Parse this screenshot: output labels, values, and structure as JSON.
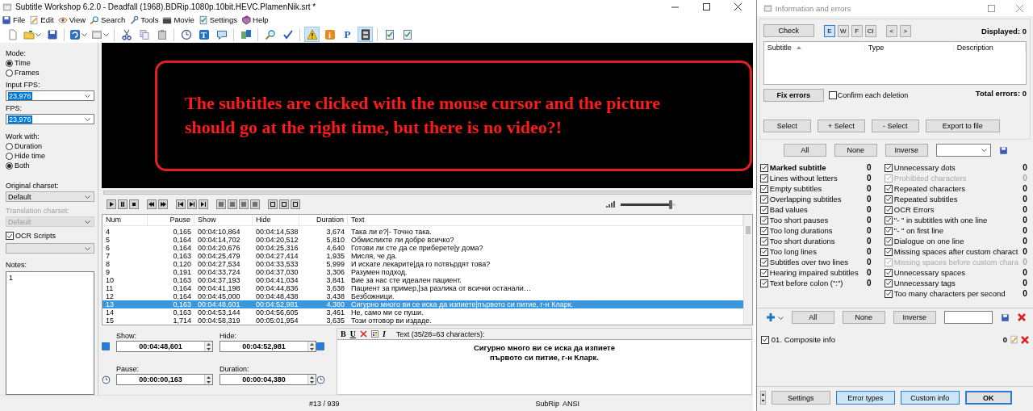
{
  "window": {
    "title": "Subtitle Workshop 6.2.0 - Deadfall (1968).BDRip.1080p.10bit.HEVC.PlamenNik.srt *"
  },
  "menu": [
    {
      "label": "File"
    },
    {
      "label": "Edit"
    },
    {
      "label": "View"
    },
    {
      "label": "Search"
    },
    {
      "label": "Tools"
    },
    {
      "label": "Movie"
    },
    {
      "label": "Settings"
    },
    {
      "label": "Help"
    }
  ],
  "toolbar": [
    {
      "selected": false
    },
    {
      "selected": false
    },
    {
      "selected": false
    },
    {
      "selected": false
    },
    {
      "selected": false
    },
    {
      "selected": false
    },
    {
      "selected": false
    },
    {
      "selected": false
    },
    {
      "selected": false
    },
    {
      "selected": false,
      "label": "T"
    },
    {
      "selected": false
    },
    {
      "selected": false
    },
    {
      "selected": false
    },
    {
      "selected": false
    },
    {
      "selected": true
    },
    {
      "selected": false,
      "label": "i"
    },
    {
      "selected": false,
      "label": "P"
    },
    {
      "selected": true
    },
    {
      "selected": false
    },
    {
      "selected": false
    }
  ],
  "side_panel": {
    "mode": {
      "label": "Mode:",
      "options": [
        {
          "label": "Time",
          "selected": true
        },
        {
          "label": "Frames",
          "selected": false
        }
      ]
    },
    "input_fps": {
      "label": "Input FPS:",
      "value": "23,976",
      "highlighted": true
    },
    "fps": {
      "label": "FPS:",
      "value": "23,976",
      "highlighted": true
    },
    "work_with": {
      "label": "Work with:",
      "options": [
        {
          "label": "Duration",
          "selected": false
        },
        {
          "label": "Hide time",
          "selected": false
        },
        {
          "label": "Both",
          "selected": true
        }
      ]
    },
    "original_charset": {
      "label": "Original charset:",
      "value": "Default",
      "disabled": false
    },
    "translation_charset": {
      "label": "Translation charset:",
      "value": "Default",
      "disabled": true
    },
    "ocr_scripts": {
      "label": "OCR Scripts",
      "checked": true
    },
    "notes": {
      "label": "Notes:",
      "value": "1"
    }
  },
  "video": {
    "annotation": "The subtitles are clicked with the mouse cursor and the picture should go at the right time, but there is no video?!"
  },
  "player": {
    "seek": {
      "level": 0
    },
    "volume": {
      "level": 0.92
    }
  },
  "table": {
    "columns": [
      "Num",
      "Pause",
      "Show",
      "Hide",
      "Duration",
      "Text"
    ],
    "rows": [
      {
        "cells": [
          "4",
          "0,165",
          "00:04:10,864",
          "00:04:14,538",
          "3,674",
          "Така ли е?|- Точно така."
        ],
        "selected": false
      },
      {
        "cells": [
          "5",
          "0,164",
          "00:04:14,702",
          "00:04:20,512",
          "5,810",
          "Обмислихте ли добре всичко?"
        ],
        "selected": false
      },
      {
        "cells": [
          "6",
          "0,164",
          "00:04:20,676",
          "00:04:25,316",
          "4,640",
          "Готови ли сте да се приберете|у дома?"
        ],
        "selected": false
      },
      {
        "cells": [
          "7",
          "0,163",
          "00:04:25,479",
          "00:04:27,414",
          "1,935",
          "Мисля, че да."
        ],
        "selected": false
      },
      {
        "cells": [
          "8",
          "0,120",
          "00:04:27,534",
          "00:04:33,533",
          "5,999",
          "И искате лекарите|да го потвърдят това?"
        ],
        "selected": false
      },
      {
        "cells": [
          "9",
          "0,191",
          "00:04:33,724",
          "00:04:37,030",
          "3,306",
          "Разумен подход."
        ],
        "selected": false
      },
      {
        "cells": [
          "10",
          "0,163",
          "00:04:37,193",
          "00:04:41,034",
          "3,841",
          "Вие за нас сте идеален пациент."
        ],
        "selected": false
      },
      {
        "cells": [
          "11",
          "0,164",
          "00:04:41,198",
          "00:04:44,836",
          "3,638",
          "Пациент за пример,|за разлика от всички останали…"
        ],
        "selected": false
      },
      {
        "cells": [
          "12",
          "0,164",
          "00:04:45,000",
          "00:04:48,438",
          "3,438",
          "Безбожници."
        ],
        "selected": false
      },
      {
        "cells": [
          "13",
          "0,163",
          "00:04:48,601",
          "00:04:52,981",
          "4,380",
          "Сигурно много ви се иска да изпиете|първото си питие, г-н Кларк."
        ],
        "selected": true
      },
      {
        "cells": [
          "14",
          "0,163",
          "00:04:53,144",
          "00:04:56,605",
          "3,461",
          "Не, само ми се пуши."
        ],
        "selected": false
      },
      {
        "cells": [
          "15",
          "1,714",
          "00:04:58,319",
          "00:05:01,954",
          "3,635",
          "Този отговор ви издаде."
        ],
        "selected": false
      }
    ]
  },
  "editor": {
    "show": {
      "label": "Show:",
      "value": "00:04:48,601"
    },
    "hide": {
      "label": "Hide:",
      "value": "00:04:52,981"
    },
    "pause": {
      "label": "Pause:",
      "value": "00:00:00,163"
    },
    "duration": {
      "label": "Duration:",
      "value": "00:00:04,380"
    },
    "format_buttons": [
      {
        "kind": "bold",
        "label": "B"
      },
      {
        "kind": "underline",
        "label": "U"
      },
      {
        "kind": "clear"
      },
      {
        "kind": "color"
      },
      {
        "kind": "italic",
        "label": "I"
      }
    ],
    "text_label": "Text (35/28=63 characters):",
    "text_lines": [
      "Сигурно много ви се иска да изпиете",
      "първото си питие, г-н Кларк."
    ]
  },
  "status_bar": {
    "position": "#13 / 939",
    "format": "SubRip",
    "charset": "ANSI"
  },
  "info_panel": {
    "title": "Information and errors",
    "check_button": "Check",
    "filters": [
      {
        "label": "E",
        "selected": true
      },
      {
        "label": "W",
        "selected": false
      },
      {
        "label": "F",
        "selected": false
      },
      {
        "label": "CI",
        "selected": false
      }
    ],
    "nav": [
      "<",
      ">"
    ],
    "displayed": "Displayed: 0",
    "error_columns": [
      "Subtitle",
      "Type",
      "Description"
    ],
    "fix_button": "Fix errors",
    "confirm": {
      "label": "Confirm each deletion",
      "checked": false
    },
    "total": "Total errors: 0",
    "select_buttons": [
      "Select",
      "+ Select",
      "- Select",
      "Export to file"
    ],
    "filter_buttons": [
      "All",
      "None",
      "Inverse"
    ],
    "checks_left": [
      {
        "label": "Marked subtitle",
        "checked": true,
        "disabled": false,
        "bold": true,
        "count": "0"
      },
      {
        "label": "Lines without letters",
        "checked": true,
        "disabled": false,
        "bold": false,
        "count": "0"
      },
      {
        "label": "Empty subtitles",
        "checked": true,
        "disabled": false,
        "bold": false,
        "count": "0"
      },
      {
        "label": "Overlapping subtitles",
        "checked": true,
        "disabled": false,
        "bold": false,
        "count": "0"
      },
      {
        "label": "Bad values",
        "checked": true,
        "disabled": false,
        "bold": false,
        "count": "0"
      },
      {
        "label": "Too short pauses",
        "checked": true,
        "disabled": false,
        "bold": false,
        "count": "0"
      },
      {
        "label": "Too long durations",
        "checked": true,
        "disabled": false,
        "bold": false,
        "count": "0"
      },
      {
        "label": "Too short durations",
        "checked": true,
        "disabled": false,
        "bold": false,
        "count": "0"
      },
      {
        "label": "Too long lines",
        "checked": true,
        "disabled": false,
        "bold": false,
        "count": "0"
      },
      {
        "label": "Subtitles over two lines",
        "checked": true,
        "disabled": false,
        "bold": false,
        "count": "0"
      },
      {
        "label": "Hearing impaired subtitles",
        "checked": true,
        "disabled": false,
        "bold": false,
        "count": "0"
      },
      {
        "label": "Text before colon (\":\")",
        "checked": true,
        "disabled": false,
        "bold": false,
        "count": "0"
      }
    ],
    "checks_right": [
      {
        "label": "Unnecessary dots",
        "checked": true,
        "disabled": false,
        "bold": false,
        "count": "0"
      },
      {
        "label": "Prohibited characters",
        "checked": true,
        "disabled": true,
        "bold": false,
        "count": "0"
      },
      {
        "label": "Repeated characters",
        "checked": true,
        "disabled": false,
        "bold": false,
        "count": "0"
      },
      {
        "label": "Repeated subtitles",
        "checked": true,
        "disabled": false,
        "bold": false,
        "count": "0"
      },
      {
        "label": "OCR Errors",
        "checked": true,
        "disabled": false,
        "bold": false,
        "count": "0"
      },
      {
        "label": "\"- \" in subtitles with one line",
        "checked": true,
        "disabled": false,
        "bold": false,
        "count": "0"
      },
      {
        "label": "\"- \" on first line",
        "checked": true,
        "disabled": false,
        "bold": false,
        "count": "0"
      },
      {
        "label": "Dialogue on one line",
        "checked": true,
        "disabled": false,
        "bold": false,
        "count": "0"
      },
      {
        "label": "Missing spaces after custom charact",
        "checked": true,
        "disabled": false,
        "bold": false,
        "count": "0"
      },
      {
        "label": "Missing spaces before custom chara",
        "checked": true,
        "disabled": true,
        "bold": false,
        "count": "0"
      },
      {
        "label": "Unnecessary spaces",
        "checked": true,
        "disabled": false,
        "bold": false,
        "count": "0"
      },
      {
        "label": "Unnecessary tags",
        "checked": true,
        "disabled": false,
        "bold": false,
        "count": "0"
      },
      {
        "label": "Too many characters per second",
        "checked": true,
        "disabled": false,
        "bold": false,
        "count": "0"
      }
    ],
    "custom_buttons": [
      "All",
      "None",
      "Inverse"
    ],
    "custom_items": [
      {
        "label": "01. Composite info",
        "checked": true,
        "count": "0"
      }
    ],
    "bottom_buttons": [
      {
        "label": "Settings",
        "selected": false,
        "default": false
      },
      {
        "label": "Error types",
        "selected": true,
        "default": false
      },
      {
        "label": "Custom info",
        "selected": true,
        "default": false
      },
      {
        "label": "OK",
        "selected": false,
        "default": true
      }
    ]
  }
}
